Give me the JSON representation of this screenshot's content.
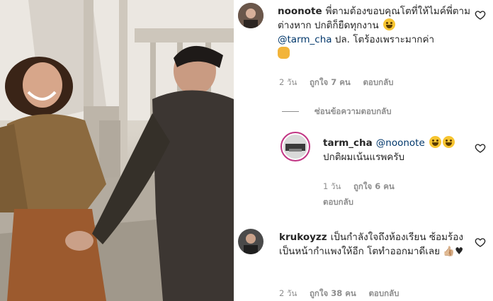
{
  "comments": [
    {
      "username": "noonote",
      "text": "พี่ตามต้องขอบคุณโตที่ให้ไมค์พี่ตามต่างหาก ปกติก็ยืดทุกงาน",
      "mention": "@tarm_cha",
      "text2": "ปล. โตร้องเพราะมากค่า",
      "age": "2 วัน",
      "likes": "ถูกใจ 7 คน",
      "reply": "ตอบกลับ"
    },
    {
      "username": "tarm_cha",
      "mention": "@noonote",
      "text": "ปกติผมเน้นแรพครับ",
      "age": "1 วัน",
      "likes": "ถูกใจ 6 คน",
      "reply": "ตอบกลับ"
    },
    {
      "username": "krukoyzz",
      "text": "เป็นกำลังใจถึงห้องเรียน ซ้อมร้องเป็นหน้ากำแพงให้อีก โตทำออกมาดีเลย",
      "emoji_tail": "👍🏼♥",
      "age": "2 วัน",
      "likes": "ถูกใจ 38 คน",
      "reply": "ตอบกลับ"
    }
  ],
  "hide_replies": "ซ่อนข้อความตอบกลับ",
  "icons": {
    "heart": "heart-outline-icon"
  },
  "colors": {
    "text": "#262626",
    "meta": "#8e8e8e",
    "mention": "#00376b"
  }
}
